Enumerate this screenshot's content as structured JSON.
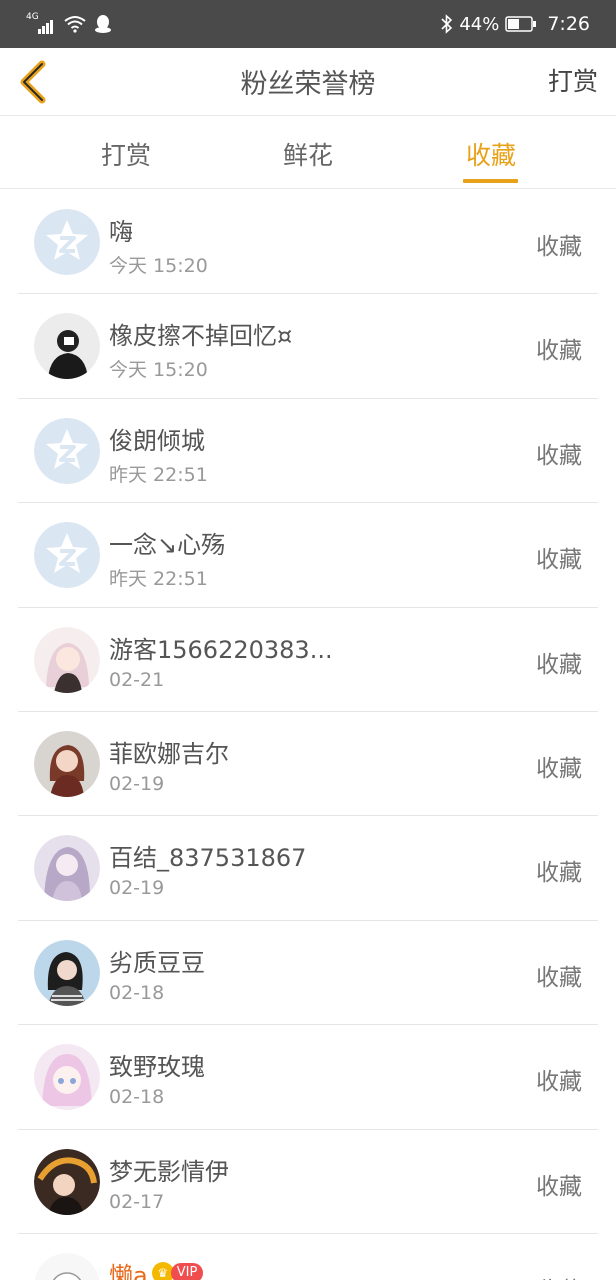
{
  "status_bar": {
    "network": "4G",
    "battery": "44%",
    "time": "7:26"
  },
  "header": {
    "title": "粉丝荣誉榜",
    "right_action": "打赏"
  },
  "tabs": [
    {
      "label": "打赏",
      "active": false
    },
    {
      "label": "鲜花",
      "active": false
    },
    {
      "label": "收藏",
      "active": true
    }
  ],
  "colors": {
    "accent": "#e8a21a",
    "status_bar": "#4a4a4a",
    "vip": "#f04e4e",
    "highlight_name": "#e86a1a"
  },
  "fans": [
    {
      "name": "嗨",
      "time": "今天 15:20",
      "action": "收藏",
      "avatar": "qq-default-avatar"
    },
    {
      "name": "橡皮擦不掉回忆¤",
      "time": "今天 15:20",
      "action": "收藏",
      "avatar": "photo-avatar"
    },
    {
      "name": "俊朗倾城",
      "time": "昨天 22:51",
      "action": "收藏",
      "avatar": "qq-default-avatar"
    },
    {
      "name": "一念↘心殇",
      "time": "昨天 22:51",
      "action": "收藏",
      "avatar": "qq-default-avatar"
    },
    {
      "name": "游客1566220383...",
      "time": "02-21",
      "action": "收藏",
      "avatar": "anime-avatar"
    },
    {
      "name": "菲欧娜吉尔",
      "time": "02-19",
      "action": "收藏",
      "avatar": "anime-avatar"
    },
    {
      "name": "百结_837531867",
      "time": "02-19",
      "action": "收藏",
      "avatar": "anime-avatar"
    },
    {
      "name": "劣质豆豆",
      "time": "02-18",
      "action": "收藏",
      "avatar": "photo-avatar"
    },
    {
      "name": "致野玫瑰",
      "time": "02-18",
      "action": "收藏",
      "avatar": "anime-avatar"
    },
    {
      "name": "梦无影情伊",
      "time": "02-17",
      "action": "收藏",
      "avatar": "anime-avatar"
    },
    {
      "name": "懒a",
      "time": "",
      "action": "收藏",
      "avatar": "cartoon-avatar",
      "vip_label": "VIP"
    }
  ]
}
